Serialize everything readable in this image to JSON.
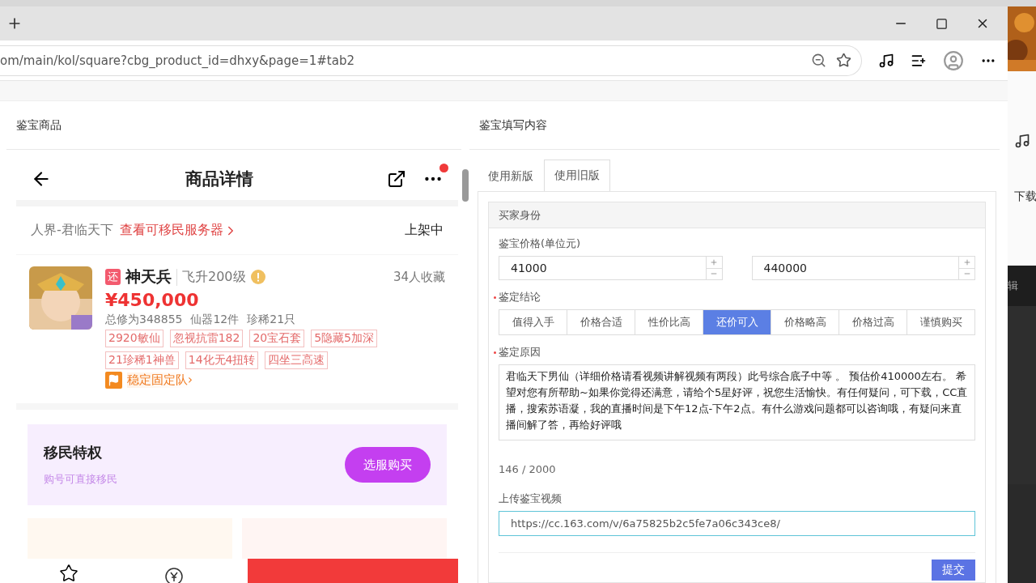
{
  "browser": {
    "url": "om/main/kol/square?cbg_product_id=dhxy&page=1#tab2"
  },
  "left_panel": {
    "title": "鉴宝商品",
    "phone": {
      "title": "商品详情",
      "notification_dot": true,
      "server": "人界-君临天下",
      "server_link": "查看可移民服务器",
      "status": "上架中",
      "product": {
        "badge": "还",
        "name": "神天兵",
        "level": "飞升200级",
        "favorites": "34人收藏",
        "price": "¥450,000",
        "stats": [
          "总修为348855",
          "仙器12件",
          "珍稀21只"
        ],
        "tags": [
          "2920敏仙",
          "忽视抗雷182",
          "20宝石套",
          "5隐藏5加深",
          "21珍稀1神兽",
          "14化无4扭转",
          "四坐三高速"
        ],
        "team": "稳定固定队›"
      },
      "migration": {
        "title": "移民特权",
        "subtitle": "购号可直接移民",
        "button": "选服购买"
      }
    }
  },
  "right_panel": {
    "title": "鉴宝填写内容",
    "tabs": [
      {
        "label": "使用新版",
        "selected": false
      },
      {
        "label": "使用旧版",
        "selected": true
      }
    ],
    "section": "买家身份",
    "price_label": "鉴宝价格(单位元)",
    "price_min": "41000",
    "price_max": "440000",
    "conclusion_label": "鉴定结论",
    "conclusions": [
      {
        "label": "值得入手",
        "selected": false
      },
      {
        "label": "价格合适",
        "selected": false
      },
      {
        "label": "性价比高",
        "selected": false
      },
      {
        "label": "还价可入",
        "selected": true
      },
      {
        "label": "价格略高",
        "selected": false
      },
      {
        "label": "价格过高",
        "selected": false
      },
      {
        "label": "谨慎购买",
        "selected": false
      }
    ],
    "reason_label": "鉴定原因",
    "reason": "君临天下男仙（详细价格请看视频讲解视频有两段）此号综合底子中等 。 预估价410000左右。 希望对您有所帮助~如果你觉得还满意，请给个5星好评，祝您生活愉快。有任何疑问，可下载，CC直播，搜索苏语凝，我的直播时间是下午12点-下午2点。有什么游戏问题都可以咨询哦，有疑问来直播间解了答，再给好评哦",
    "counter": "146 / 2000",
    "video_label": "上传鉴宝视频",
    "video_url": "https://cc.163.com/v/6a75825b2c5fe7a06c343ce8/",
    "submit": "提交"
  },
  "background_window": {
    "labels": [
      "下载",
      "辑"
    ]
  }
}
